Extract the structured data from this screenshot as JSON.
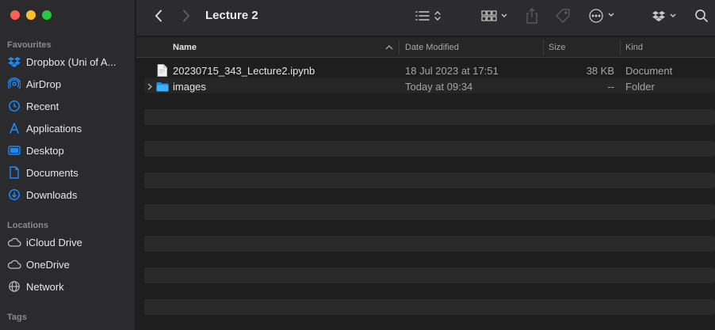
{
  "window": {
    "title": "Lecture 2"
  },
  "sidebar": {
    "favourites_title": "Favourites",
    "favourites": [
      {
        "label": "Dropbox (Uni of A...",
        "icon": "dropbox-icon"
      },
      {
        "label": "AirDrop",
        "icon": "airdrop-icon"
      },
      {
        "label": "Recent",
        "icon": "clock-icon"
      },
      {
        "label": "Applications",
        "icon": "applications-icon"
      },
      {
        "label": "Desktop",
        "icon": "desktop-icon"
      },
      {
        "label": "Documents",
        "icon": "document-icon"
      },
      {
        "label": "Downloads",
        "icon": "download-icon"
      }
    ],
    "locations_title": "Locations",
    "locations": [
      {
        "label": "iCloud Drive",
        "icon": "cloud-icon"
      },
      {
        "label": "OneDrive",
        "icon": "cloud-icon"
      },
      {
        "label": "Network",
        "icon": "globe-icon"
      }
    ],
    "tags_title": "Tags"
  },
  "columns": {
    "name": "Name",
    "date": "Date Modified",
    "size": "Size",
    "kind": "Kind"
  },
  "files": [
    {
      "name": "20230715_343_Lecture2.ipynb",
      "date": "18 Jul 2023 at 17:51",
      "size": "38 KB",
      "kind": "Document",
      "icon": "file-icon"
    },
    {
      "name": "images",
      "date": "Today at 09:34",
      "size": "--",
      "kind": "Folder",
      "icon": "folder-icon"
    }
  ],
  "colors": {
    "accent": "#1a8cff",
    "sidebar_bg": "#2b2a2c",
    "window_bg": "#1e1e1e"
  }
}
